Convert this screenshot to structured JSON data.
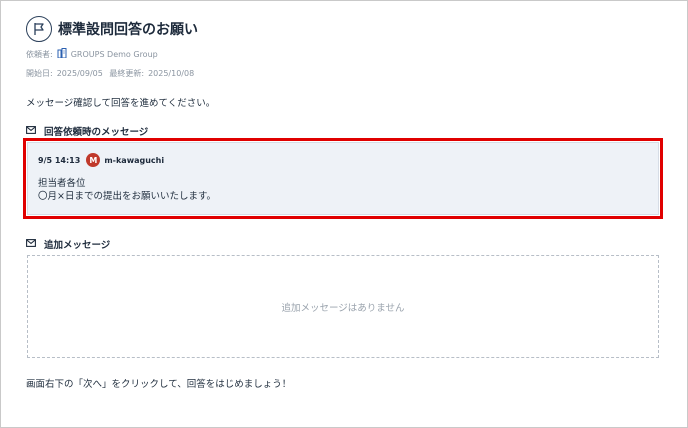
{
  "header": {
    "icon": "flag-icon",
    "title": "標準設問回答のお願い"
  },
  "meta": {
    "requester_label": "依頼者:",
    "requester_icon": "building-icon",
    "requester_value": "GROUPS Demo Group",
    "start_label": "開始日:",
    "start_value": "2025/09/05",
    "updated_label": "最終更新:",
    "updated_value": "2025/10/08"
  },
  "intro_text": "メッセージ確認して回答を進めてください。",
  "request_section": {
    "icon": "mail-icon",
    "title": "回答依頼時のメッセージ",
    "message": {
      "timestamp": "9/5 14:13",
      "avatar_initial": "M",
      "avatar_color": "#c0392b",
      "author": "m-kawaguchi",
      "line1": "担当者各位",
      "line2": "〇月×日までの提出をお願いいたします。"
    },
    "highlight_color": "#e00000"
  },
  "additional_section": {
    "icon": "mail-icon",
    "title": "追加メッセージ",
    "empty_text": "追加メッセージはありません"
  },
  "footer_note": "画面右下の「次へ」をクリックして、回答をはじめましょう！"
}
